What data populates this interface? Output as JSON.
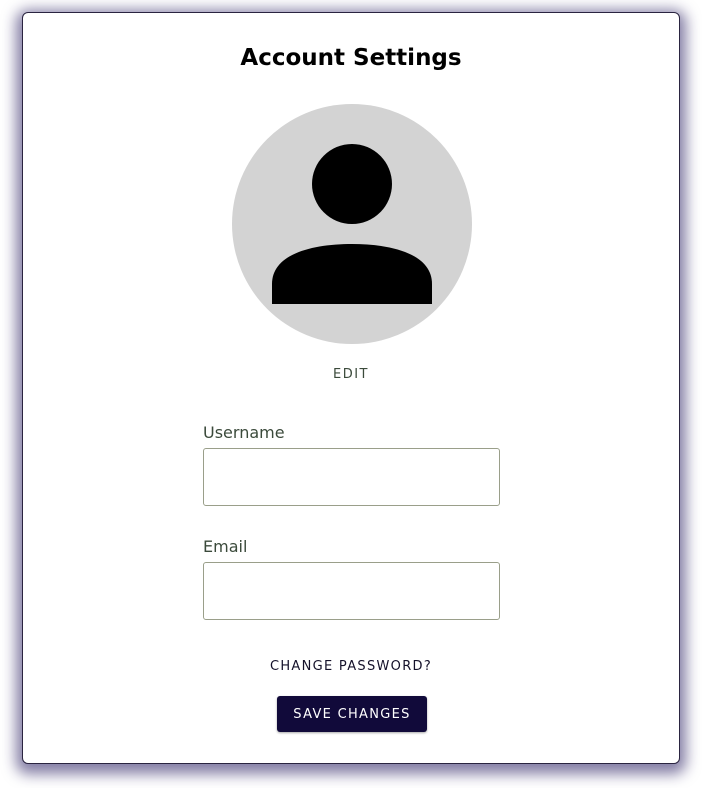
{
  "page": {
    "title": "Account Settings"
  },
  "avatar": {
    "icon": "user-silhouette-icon",
    "background_color": "#d3d3d3",
    "edit_label": "EDIT"
  },
  "form": {
    "username": {
      "label": "Username",
      "value": "",
      "placeholder": ""
    },
    "email": {
      "label": "Email",
      "value": "",
      "placeholder": ""
    }
  },
  "actions": {
    "change_password_label": "CHANGE PASSWORD?",
    "save_label": "SAVE CHANGES"
  },
  "colors": {
    "accent": "#110a3a",
    "label_text": "#3b4a3b",
    "card_shadow": "#1e125a"
  }
}
